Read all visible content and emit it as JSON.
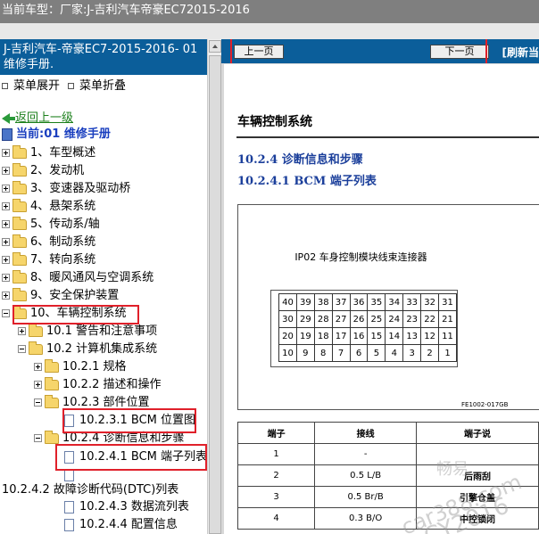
{
  "topbar": {
    "label": "当前车型：",
    "vehicle": "厂家:J-吉利汽车帝豪EC72015-2016"
  },
  "left": {
    "header": "J-吉利汽车-帝豪EC7-2015-2016- 01 维修手册.",
    "expand_all": "菜单展开",
    "collapse_all": "菜单折叠",
    "back": "返回上一级",
    "current": "当前:01 维修手册",
    "tree": [
      "1、车型概述",
      "2、发动机",
      "3、变速器及驱动桥",
      "4、悬架系统",
      "5、传动系/轴",
      "6、制动系统",
      "7、转向系统",
      "8、暖风通风与空调系统",
      "9、安全保护装置",
      "10、车辆控制系统",
      "10.1 警告和注意事项",
      "10.2 计算机集成系统",
      "10.2.1 规格",
      "10.2.2 描述和操作",
      "10.2.3 部件位置",
      "10.2.3.1 BCM 位置图",
      "10.2.4 诊断信息和步骤",
      "10.2.4.1 BCM 端子列表",
      "10.2.4.2 故障诊断代码(DTC)列表",
      "10.2.4.3 数据流列表",
      "10.2.4.4 配置信息"
    ]
  },
  "right": {
    "prev": "上一页",
    "next": "下一页",
    "refresh": "[刷新当",
    "system_title": "车辆控制系统",
    "section": "10.2.4 诊断信息和步骤",
    "subsection": "10.2.4.1 BCM 端子列表",
    "connector_title": "IP02 车身控制模块线束连接器",
    "fig_code": "FE1002-017GB",
    "pins": [
      [
        "40",
        "39",
        "38",
        "37",
        "36",
        "35",
        "34",
        "33",
        "32",
        "31"
      ],
      [
        "30",
        "29",
        "28",
        "27",
        "26",
        "25",
        "24",
        "23",
        "22",
        "21"
      ],
      [
        "20",
        "19",
        "18",
        "17",
        "16",
        "15",
        "14",
        "13",
        "12",
        "11"
      ],
      [
        "10",
        "9",
        "8",
        "7",
        "6",
        "5",
        "4",
        "3",
        "2",
        "1"
      ]
    ],
    "table_headers": [
      "端子",
      "接线",
      "端子说"
    ],
    "table_rows": [
      [
        "1",
        "-",
        ""
      ],
      [
        "2",
        "0.5 L/B",
        "后雨刮"
      ],
      [
        "3",
        "0.5 Br/B",
        "引擎仓盖"
      ],
      [
        "4",
        "0.3 B/O",
        "中控锁闭"
      ]
    ],
    "watermark": [
      "畅易",
      "car388.com",
      "CY2016"
    ]
  }
}
